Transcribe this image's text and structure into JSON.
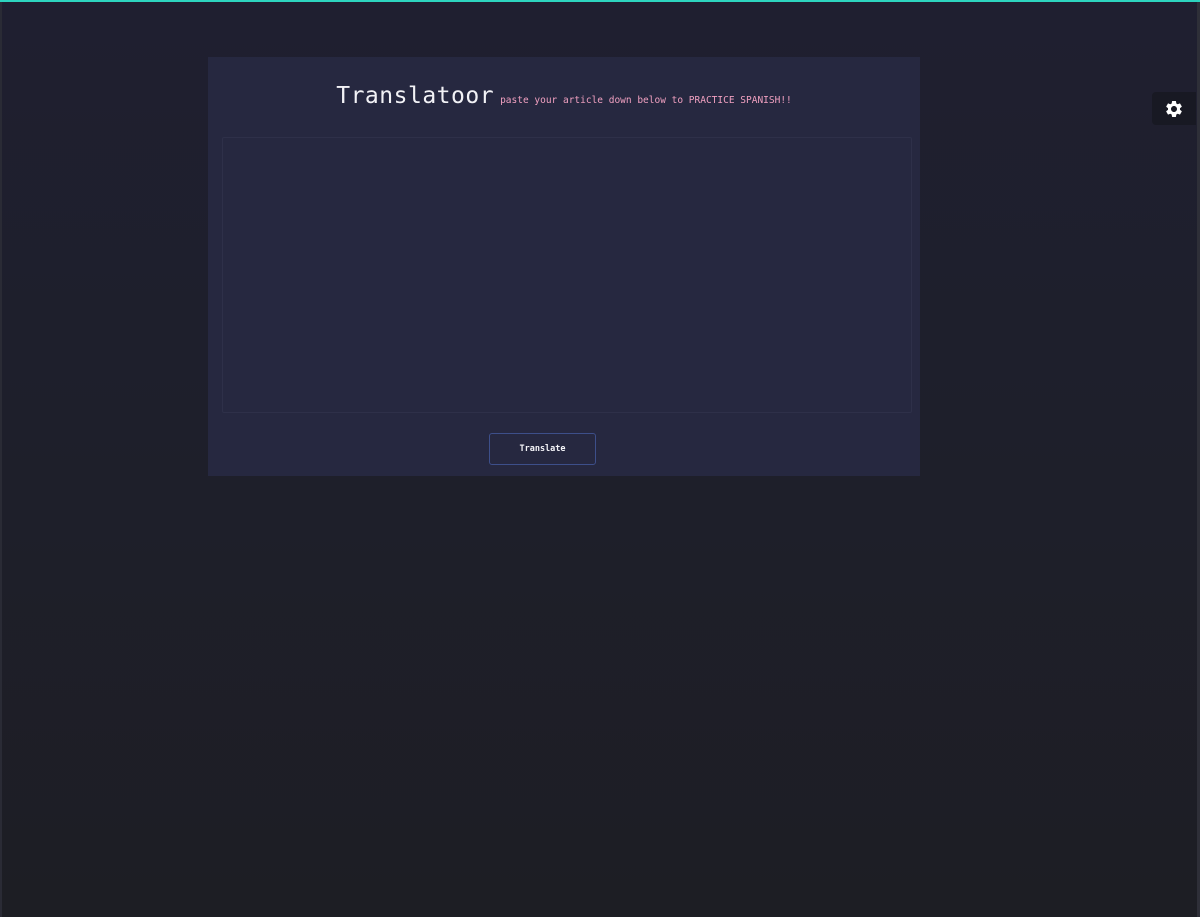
{
  "header": {
    "title": "Translatoor",
    "subtitle": "paste your article down below to PRACTICE SPANISH!!"
  },
  "article": {
    "value": "",
    "placeholder": ""
  },
  "actions": {
    "translate_label": "Translate"
  },
  "settings": {
    "icon": "gear-icon"
  },
  "colors": {
    "accent_top_line": "#2dd4bf",
    "card_background": "#262840",
    "page_background": "#1f1f30",
    "subtitle_color": "#f0a0c0",
    "button_border": "#3d4f8a"
  }
}
